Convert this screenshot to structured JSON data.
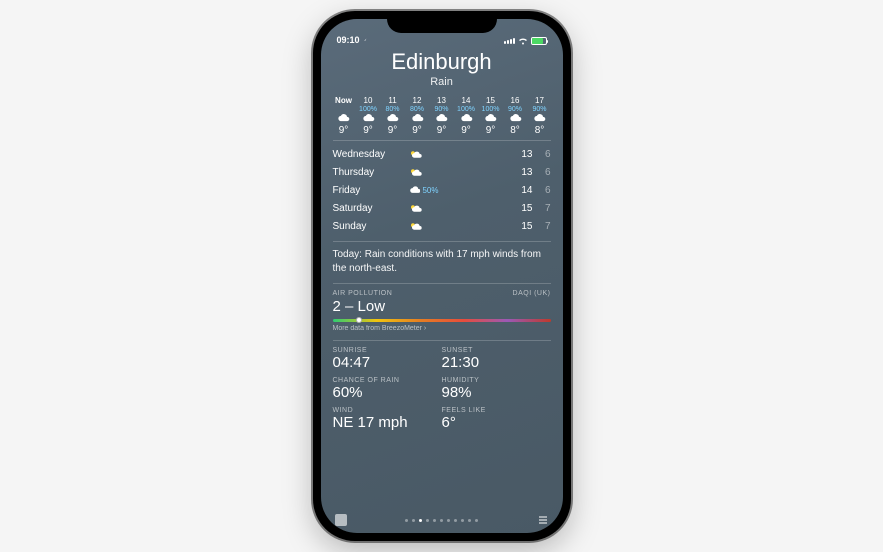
{
  "status_bar": {
    "time": "09:10"
  },
  "location": {
    "city": "Edinburgh",
    "condition": "Rain"
  },
  "hourly": [
    {
      "time": "Now",
      "precip": "",
      "temp": "9°"
    },
    {
      "time": "10",
      "precip": "100%",
      "temp": "9°"
    },
    {
      "time": "11",
      "precip": "80%",
      "temp": "9°"
    },
    {
      "time": "12",
      "precip": "80%",
      "temp": "9°"
    },
    {
      "time": "13",
      "precip": "90%",
      "temp": "9°"
    },
    {
      "time": "14",
      "precip": "100%",
      "temp": "9°"
    },
    {
      "time": "15",
      "precip": "100%",
      "temp": "9°"
    },
    {
      "time": "16",
      "precip": "90%",
      "temp": "8°"
    },
    {
      "time": "17",
      "precip": "90%",
      "temp": "8°"
    }
  ],
  "daily": [
    {
      "day": "Wednesday",
      "precip": "",
      "hi": "13",
      "lo": "6",
      "icon": "partly-sunny"
    },
    {
      "day": "Thursday",
      "precip": "",
      "hi": "13",
      "lo": "6",
      "icon": "partly-sunny"
    },
    {
      "day": "Friday",
      "precip": "50%",
      "hi": "14",
      "lo": "6",
      "icon": "rain"
    },
    {
      "day": "Saturday",
      "precip": "",
      "hi": "15",
      "lo": "7",
      "icon": "partly-sunny"
    },
    {
      "day": "Sunday",
      "precip": "",
      "hi": "15",
      "lo": "7",
      "icon": "partly-sunny"
    }
  ],
  "summary": "Today: Rain conditions with 17 mph winds from the north-east.",
  "air_quality": {
    "label": "AIR POLLUTION",
    "standard": "DAQI (UK)",
    "value": "2 – Low",
    "marker_percent": 12,
    "more": "More data from BreezoMeter ›"
  },
  "metrics": {
    "sunrise": {
      "label": "SUNRISE",
      "value": "04:47"
    },
    "sunset": {
      "label": "SUNSET",
      "value": "21:30"
    },
    "chance": {
      "label": "CHANCE OF RAIN",
      "value": "60%"
    },
    "humidity": {
      "label": "HUMIDITY",
      "value": "98%"
    },
    "wind": {
      "label": "WIND",
      "value": "NE 17 mph"
    },
    "feels": {
      "label": "FEELS LIKE",
      "value": "6°"
    }
  },
  "paging": {
    "pages": 10,
    "active": 1
  }
}
